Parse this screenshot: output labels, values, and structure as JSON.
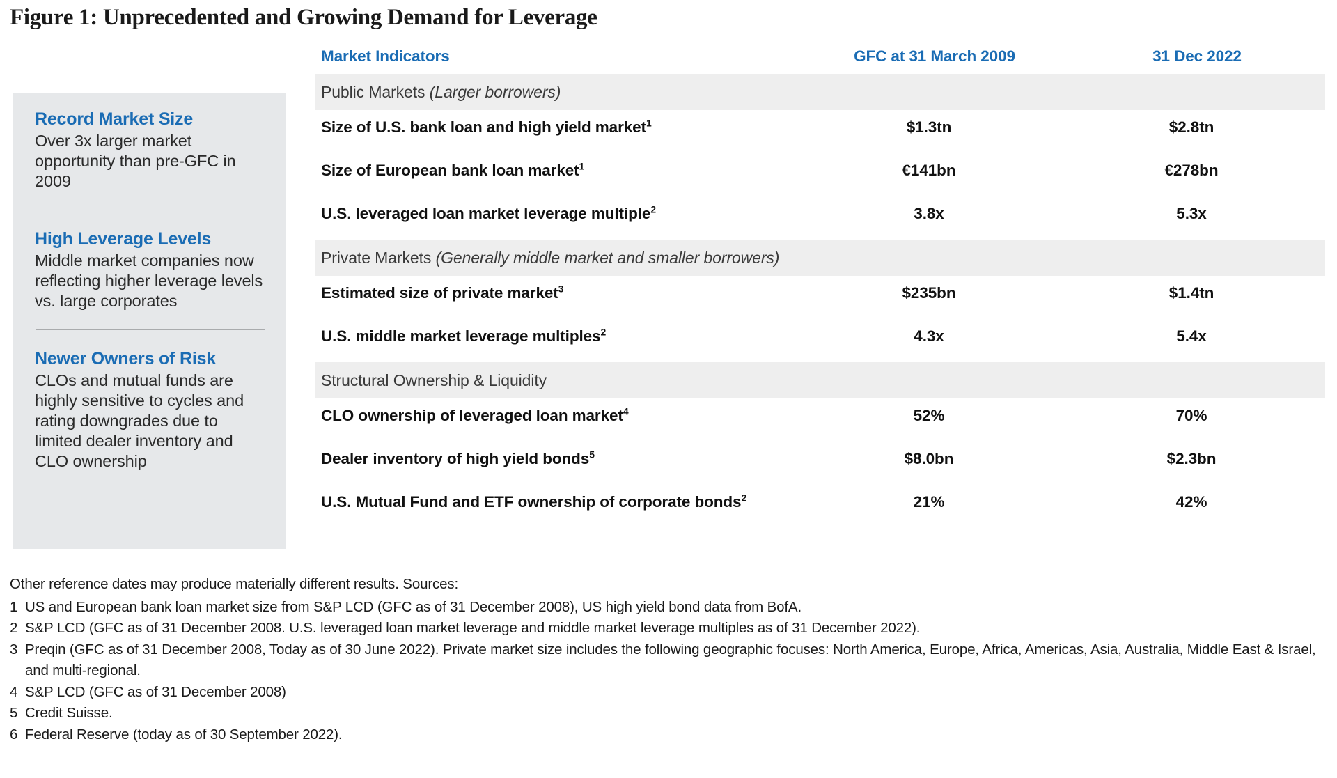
{
  "figure": {
    "title": "Figure 1: Unprecedented and Growing Demand for Leverage"
  },
  "colors": {
    "accent_blue": "#1a6cb4",
    "sidebar_bg": "#e6e8ea",
    "section_band_bg": "#eeeeee",
    "text": "#231f20"
  },
  "sidebar": {
    "blocks": [
      {
        "heading": "Record Market Size",
        "body": "Over 3x larger market opportunity than pre-GFC in 2009"
      },
      {
        "heading": "High Leverage Levels",
        "body": "Middle market companies now reflecting higher leverage levels vs. large corporates"
      },
      {
        "heading": "Newer Owners of Risk",
        "body": "CLOs and mutual funds are highly sensitive to cycles and rating downgrades due to limited dealer inventory and CLO ownership"
      }
    ]
  },
  "table": {
    "headers": {
      "indicator": "Market Indicators",
      "gfc": "GFC at 31 March 2009",
      "today": "31 Dec 2022"
    },
    "rows": [
      {
        "type": "section",
        "label": "Public Markets ",
        "label_italic": "(Larger borrowers)"
      },
      {
        "type": "data",
        "label": "Size of U.S. bank loan and high yield market",
        "sup": "1",
        "gfc": "$1.3tn",
        "today": "$2.8tn"
      },
      {
        "type": "data",
        "label": "Size of European bank loan market",
        "sup": "1",
        "gfc": "€141bn",
        "today": "€278bn"
      },
      {
        "type": "data",
        "label": "U.S. leveraged loan market leverage multiple",
        "sup": "2",
        "gfc": "3.8x",
        "today": "5.3x"
      },
      {
        "type": "section",
        "label": "Private Markets ",
        "label_italic": "(Generally middle market and smaller borrowers)"
      },
      {
        "type": "data",
        "label": "Estimated size of private market",
        "sup": "3",
        "gfc": "$235bn",
        "today": "$1.4tn"
      },
      {
        "type": "data",
        "label": "U.S. middle market leverage multiples",
        "sup": "2",
        "gfc": "4.3x",
        "today": "5.4x"
      },
      {
        "type": "section",
        "label": "Structural Ownership & Liquidity",
        "label_italic": ""
      },
      {
        "type": "data",
        "label": "CLO ownership of leveraged loan market",
        "sup": "4",
        "gfc": "52%",
        "today": "70%"
      },
      {
        "type": "data",
        "label": "Dealer inventory of high yield bonds",
        "sup": "5",
        "gfc": "$8.0bn",
        "today": "$2.3bn"
      },
      {
        "type": "data",
        "label": "U.S. Mutual Fund and ETF ownership of corporate bonds",
        "sup": "2",
        "gfc": "21%",
        "today": "42%"
      }
    ]
  },
  "footnotes": {
    "lead": "Other reference dates may produce materially different results. Sources:",
    "items": [
      {
        "num": "1",
        "text": "US and European bank loan market size from S&P LCD (GFC as of 31 December 2008), US high yield bond data from BofA."
      },
      {
        "num": "2",
        "text": "S&P LCD (GFC as of 31 December 2008. U.S. leveraged loan market leverage and middle market leverage multiples as of 31 December 2022)."
      },
      {
        "num": "3",
        "text": "Preqin (GFC as of 31 December 2008, Today as of 30 June 2022). Private market size includes the following geographic focuses: North America, Europe, Africa, Americas, Asia, Australia, Middle East & Israel, and multi-regional."
      },
      {
        "num": "4",
        "text": "S&P LCD (GFC as of 31 December 2008)"
      },
      {
        "num": "5",
        "text": "Credit Suisse."
      },
      {
        "num": "6",
        "text": "Federal Reserve (today as of 30 September 2022)."
      }
    ]
  }
}
